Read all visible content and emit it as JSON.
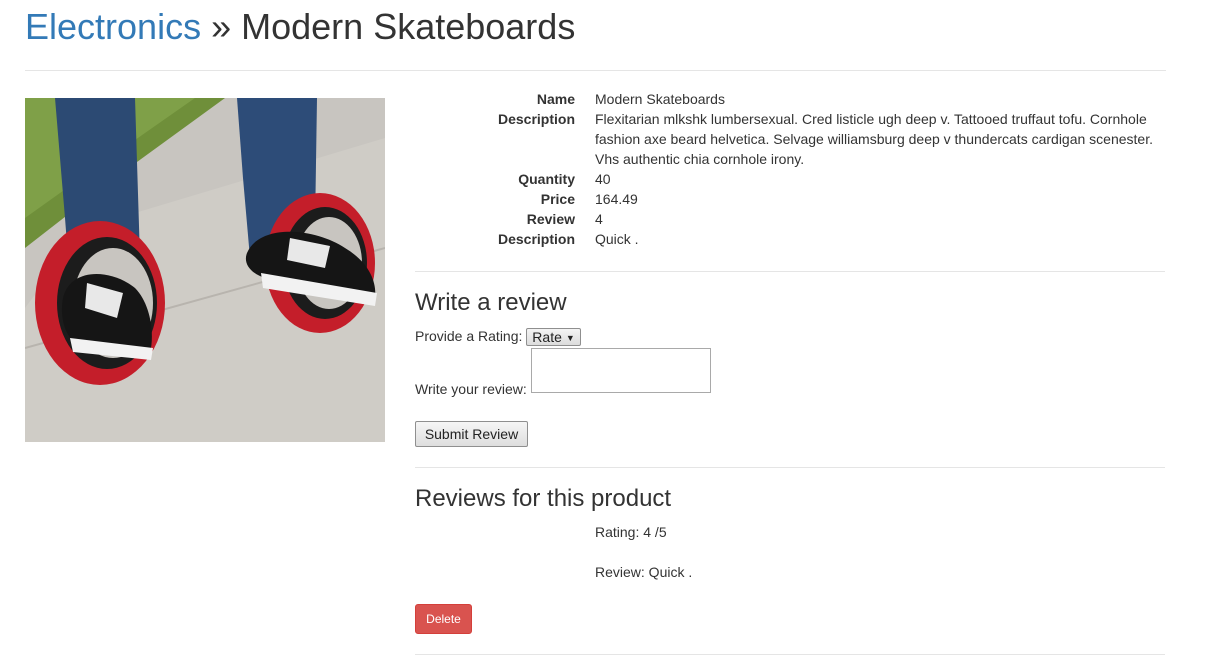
{
  "header": {
    "breadcrumb_link": "Electronics",
    "separator": "»",
    "product_title": "Modern Skateboards"
  },
  "details": [
    {
      "label": "Name",
      "value": "Modern Skateboards"
    },
    {
      "label": "Description",
      "value": "Flexitarian mlkshk lumbersexual. Cred listicle ugh deep v. Tattooed truffaut tofu. Cornhole fashion axe beard helvetica. Selvage williamsburg deep v thundercats cardigan scenester. Vhs authentic chia cornhole irony."
    },
    {
      "label": "Quantity",
      "value": "40"
    },
    {
      "label": "Price",
      "value": "164.49"
    },
    {
      "label": "Review",
      "value": "4"
    },
    {
      "label": "Description",
      "value": "Quick ."
    }
  ],
  "write_review": {
    "heading": "Write a review",
    "rating_label": "Provide a Rating:",
    "rating_selected": "Rate",
    "review_label": "Write your review:",
    "review_value": "",
    "submit_label": "Submit Review"
  },
  "reviews": {
    "heading": "Reviews for this product",
    "items": [
      {
        "rating": "Rating: 4 /5",
        "text": "Review: Quick .",
        "delete_label": "Delete"
      }
    ]
  },
  "colors": {
    "link": "#337ab7",
    "danger": "#d9534f",
    "text": "#333333"
  }
}
